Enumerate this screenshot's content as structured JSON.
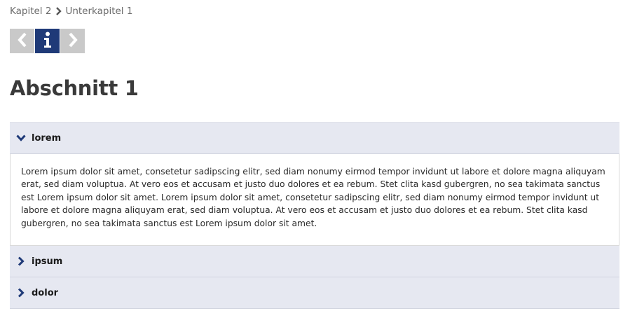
{
  "breadcrumb": {
    "items": [
      "Kapitel 2",
      "Unterkapitel 1"
    ]
  },
  "nav": {
    "prev_icon": "chevron-left-icon",
    "info_icon": "info-icon",
    "next_icon": "chevron-right-icon"
  },
  "page": {
    "title": "Abschnitt 1"
  },
  "accordion": {
    "sections": [
      {
        "label": "lorem",
        "expanded": true,
        "content": "Lorem ipsum dolor sit amet, consetetur sadipscing elitr, sed diam nonumy eirmod tempor invidunt ut labore et dolore magna aliquyam erat, sed diam voluptua. At vero eos et accusam et justo duo dolores et ea rebum. Stet clita kasd gubergren, no sea takimata sanctus est Lorem ipsum dolor sit amet. Lorem ipsum dolor sit amet, consetetur sadipscing elitr, sed diam nonumy eirmod tempor invidunt ut labore et dolore magna aliquyam erat, sed diam voluptua. At vero eos et accusam et justo duo dolores et ea rebum. Stet clita kasd gubergren, no sea takimata sanctus est Lorem ipsum dolor sit amet."
      },
      {
        "label": "ipsum",
        "expanded": false
      },
      {
        "label": "dolor",
        "expanded": false
      }
    ]
  },
  "colors": {
    "accent": "#1f3a78",
    "button_grey": "#c9c9c9",
    "accordion_header_bg": "#e6e8f1",
    "breadcrumb_text": "#6b6b6b",
    "title_text": "#3a3a3a"
  }
}
